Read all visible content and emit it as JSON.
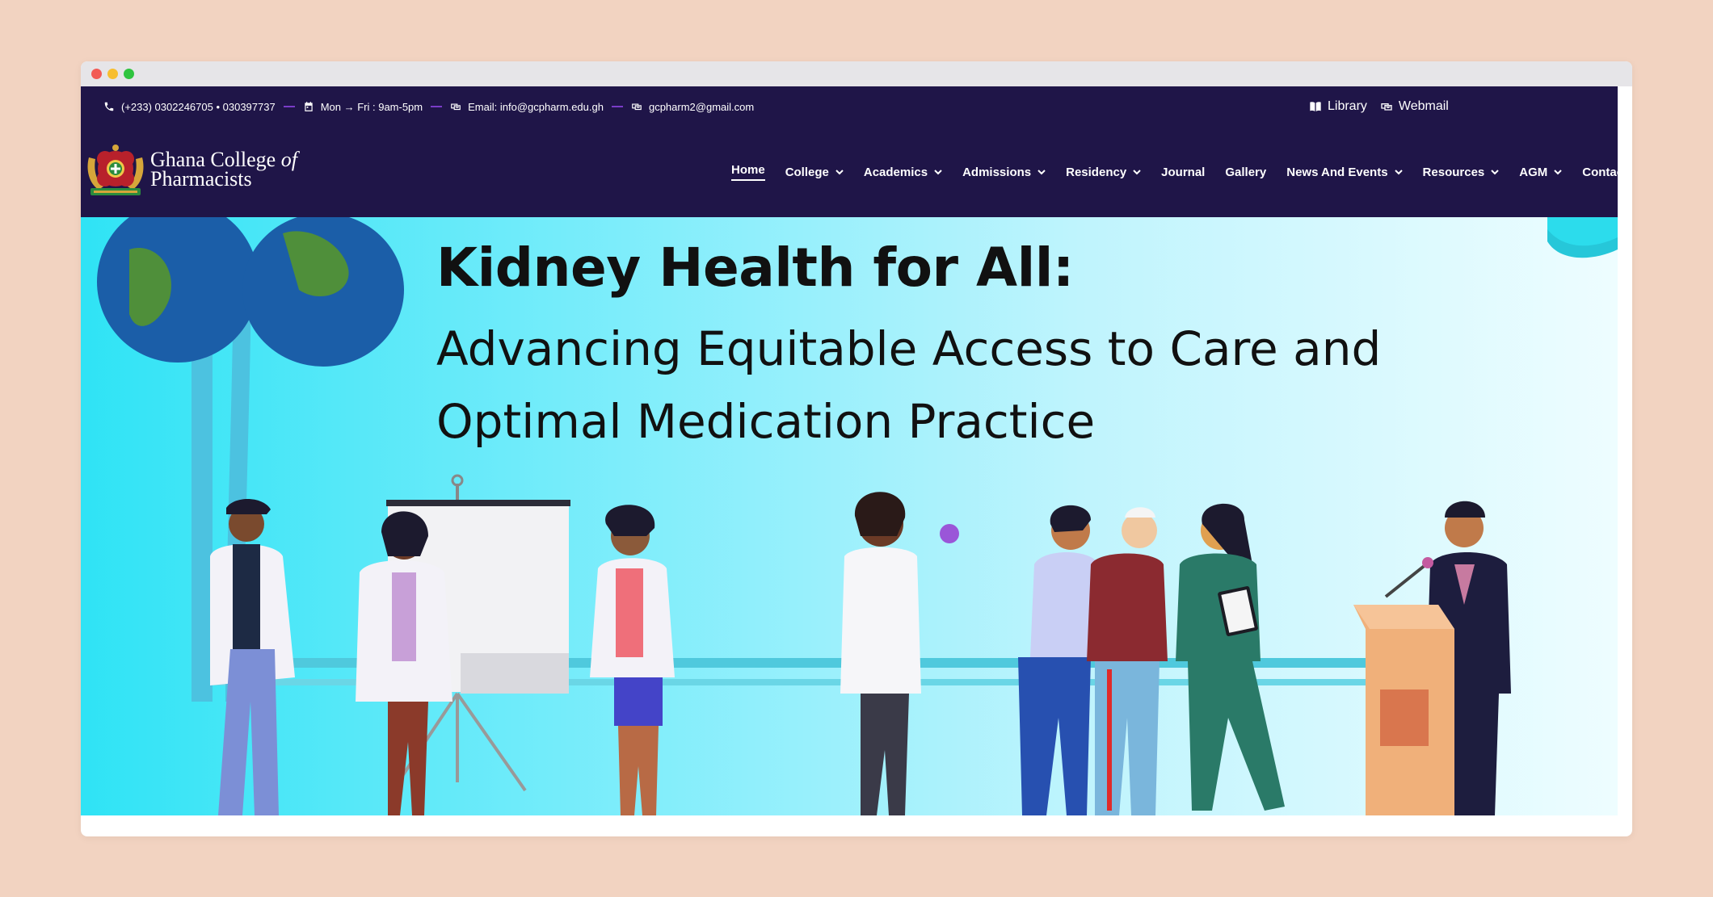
{
  "topbar": {
    "phone": "(+233) 0302246705 • 030397737",
    "hours": "Mon → Fri : 9am-5pm",
    "email": "Email: info@gcpharm.edu.gh",
    "email2": "gcpharm2@gmail.com",
    "library": "Library",
    "webmail": "Webmail"
  },
  "brand": {
    "line1": "Ghana College",
    "of": "of",
    "line2": "Pharmacists"
  },
  "nav": {
    "items": [
      {
        "label": "Home",
        "dropdown": false,
        "active": true
      },
      {
        "label": "College",
        "dropdown": true
      },
      {
        "label": "Academics",
        "dropdown": true
      },
      {
        "label": "Admissions",
        "dropdown": true
      },
      {
        "label": "Residency",
        "dropdown": true
      },
      {
        "label": "Journal",
        "dropdown": false
      },
      {
        "label": "Gallery",
        "dropdown": false
      },
      {
        "label": "News And Events",
        "dropdown": true
      },
      {
        "label": "Resources",
        "dropdown": true
      },
      {
        "label": "AGM",
        "dropdown": true
      },
      {
        "label": "Contact",
        "dropdown": false
      }
    ]
  },
  "hero": {
    "title": "Kidney Health for All:",
    "subtitle": "Advancing Equitable Access to Care and Optimal Medication Practice"
  },
  "colors": {
    "nav_bg": "#1f1548",
    "separator": "#7a3cc8",
    "hero_start": "#2fe3f5",
    "hero_end": "#eefdff"
  },
  "icons": [
    "phone-icon",
    "calendar-icon",
    "email-icon",
    "book-icon",
    "chevron-down-icon"
  ]
}
